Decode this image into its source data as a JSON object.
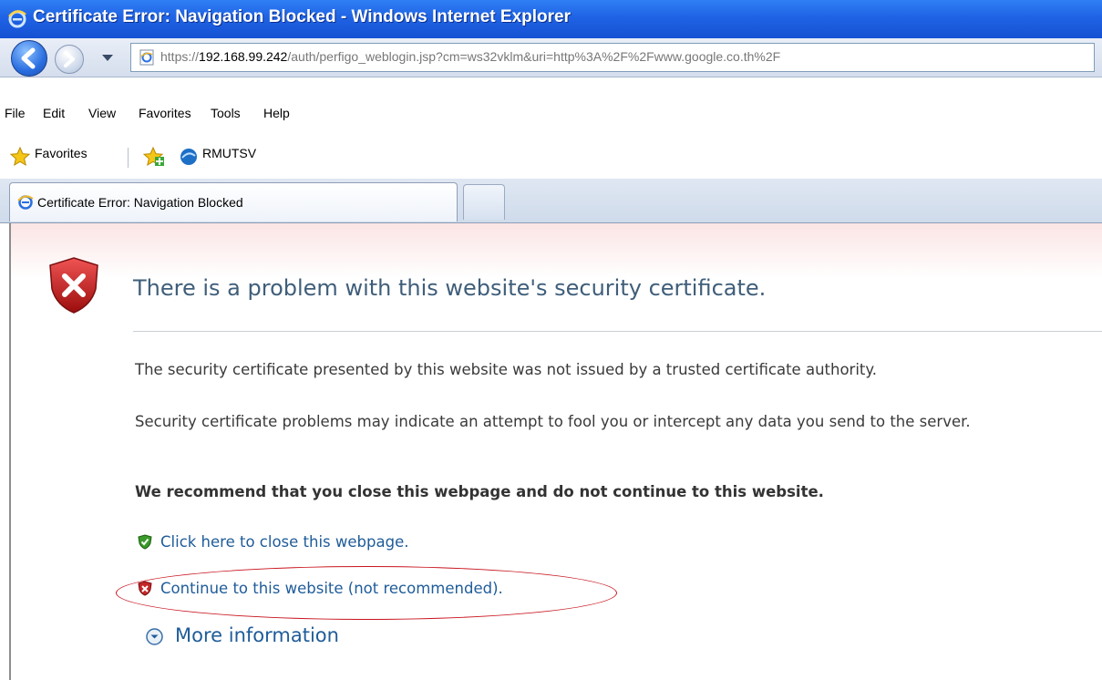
{
  "window": {
    "title": "Certificate Error: Navigation Blocked - Windows Internet Explorer"
  },
  "address_bar": {
    "scheme": "https://",
    "host": "192.168.99.242",
    "path": "/auth/perfigo_weblogin.jsp?cm=ws32vklm&uri=http%3A%2F%2Fwww.google.co.th%2F"
  },
  "menu": {
    "file": "File",
    "edit": "Edit",
    "view": "View",
    "favorites": "Favorites",
    "tools": "Tools",
    "help": "Help"
  },
  "favorites_bar": {
    "favorites_label": "Favorites",
    "site_label": "RMUTSV"
  },
  "tabs": [
    {
      "label": "Certificate Error: Navigation Blocked"
    }
  ],
  "page": {
    "heading": "There is a problem with this website's security certificate.",
    "p1": "The security certificate presented by this website was not issued by a trusted certificate authority.",
    "p2": "Security certificate problems may indicate an attempt to fool you or intercept any data you send to the server.",
    "recommendation": "We recommend that you close this webpage and do not continue to this website.",
    "link_close": "Click here to close this webpage.",
    "link_continue": "Continue to this website (not recommended).",
    "link_more": "More information"
  },
  "colors": {
    "titlebar": "#1f63e4",
    "heading": "#3f5e7a",
    "link": "#1f5c99",
    "annotation_circle": "#c8141e"
  },
  "icons": {
    "title": "ie-icon",
    "back": "back-arrow-icon",
    "forward": "forward-arrow-icon",
    "page_error": "shield-error-icon",
    "close_link": "shield-check-icon",
    "continue_link": "shield-x-icon",
    "more_info": "chevron-down-circle-icon"
  }
}
